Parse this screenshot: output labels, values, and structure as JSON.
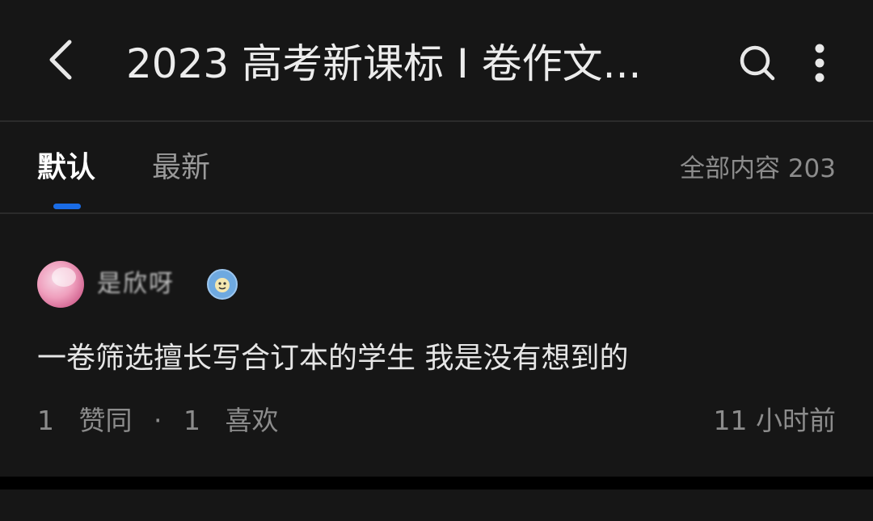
{
  "header": {
    "title": "2023 高考新课标 I 卷作文...",
    "back_icon": "chevron-left-icon",
    "search_icon": "search-icon",
    "more_icon": "more-vertical-icon"
  },
  "tabs": {
    "items": [
      {
        "label": "默认",
        "active": true
      },
      {
        "label": "最新",
        "active": false
      }
    ],
    "total_count": "全部内容 203",
    "accent_color": "#1a6ce6"
  },
  "post": {
    "author": "是欣呀",
    "author_badge_icon": "badge-icon",
    "text": "一卷筛选擅长写合订本的学生 我是没有想到的",
    "agree_count": "1",
    "agree_label": "赞同",
    "separator": "·",
    "like_count": "1",
    "like_label": "喜欢",
    "time": "11 小时前"
  }
}
